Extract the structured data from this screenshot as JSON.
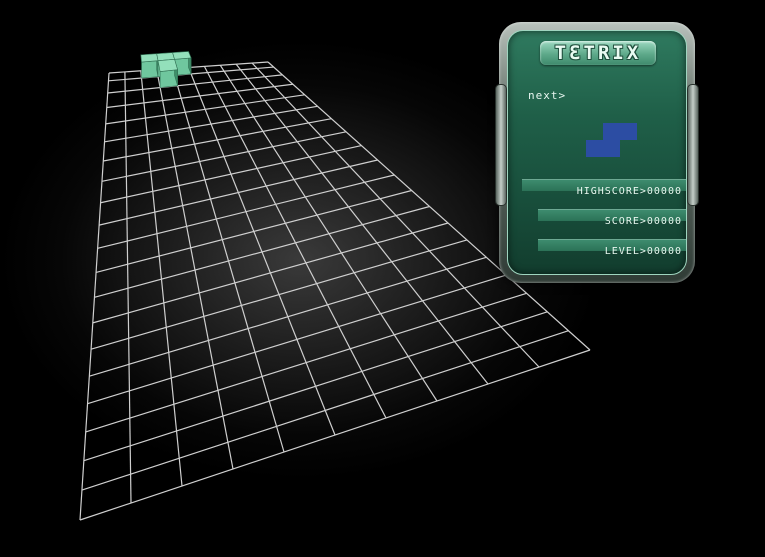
{
  "game": {
    "title": "TƐTRIX",
    "next_label": "next>",
    "stats": {
      "highscore": "HIGHSCORE>00000",
      "score": "SCORE>00000",
      "level": "LEVEL>00000"
    }
  },
  "board": {
    "columns": 10,
    "rows": 20,
    "grid_color": "#cfcfcf",
    "falling_piece": {
      "shape": "T",
      "color": "#6fc79e",
      "top_color": "#93e0bb",
      "side_color": "#3e8f69",
      "cells": [
        [
          2,
          0
        ],
        [
          3,
          0
        ],
        [
          4,
          0
        ],
        [
          3,
          1
        ]
      ]
    },
    "next_piece": {
      "shape": "S",
      "color": "#2c4da3",
      "cells": [
        [
          1,
          0
        ],
        [
          2,
          0
        ],
        [
          0,
          1
        ],
        [
          1,
          1
        ]
      ]
    }
  },
  "colors": {
    "panel_green": "#1f5f48",
    "panel_highlight": "#9cd9c0",
    "background": "#000000"
  }
}
